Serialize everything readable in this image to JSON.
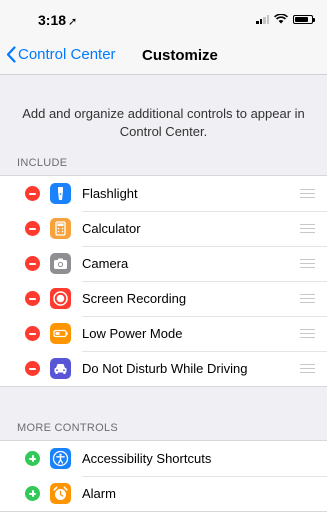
{
  "status_bar": {
    "time": "3:18",
    "location_glyph": "➚"
  },
  "nav": {
    "back_label": "Control Center",
    "title": "Customize"
  },
  "description": "Add and organize additional controls to appear in Control Center.",
  "include": {
    "header": "INCLUDE",
    "items": [
      {
        "label": "Flashlight",
        "icon": "flashlight-icon",
        "color": "#1a82fb"
      },
      {
        "label": "Calculator",
        "icon": "calculator-icon",
        "color": "#f7a33b"
      },
      {
        "label": "Camera",
        "icon": "camera-icon",
        "color": "#8e8e93"
      },
      {
        "label": "Screen Recording",
        "icon": "screen-recording-icon",
        "color": "#ff3b30"
      },
      {
        "label": "Low Power Mode",
        "icon": "low-power-mode-icon",
        "color": "#ff9500"
      },
      {
        "label": "Do Not Disturb While Driving",
        "icon": "car-icon",
        "color": "#5856d6"
      }
    ]
  },
  "more_controls": {
    "header": "MORE CONTROLS",
    "items": [
      {
        "label": "Accessibility Shortcuts",
        "icon": "accessibility-icon",
        "color": "#1a82fb"
      },
      {
        "label": "Alarm",
        "icon": "alarm-icon",
        "color": "#ff9500"
      }
    ]
  }
}
